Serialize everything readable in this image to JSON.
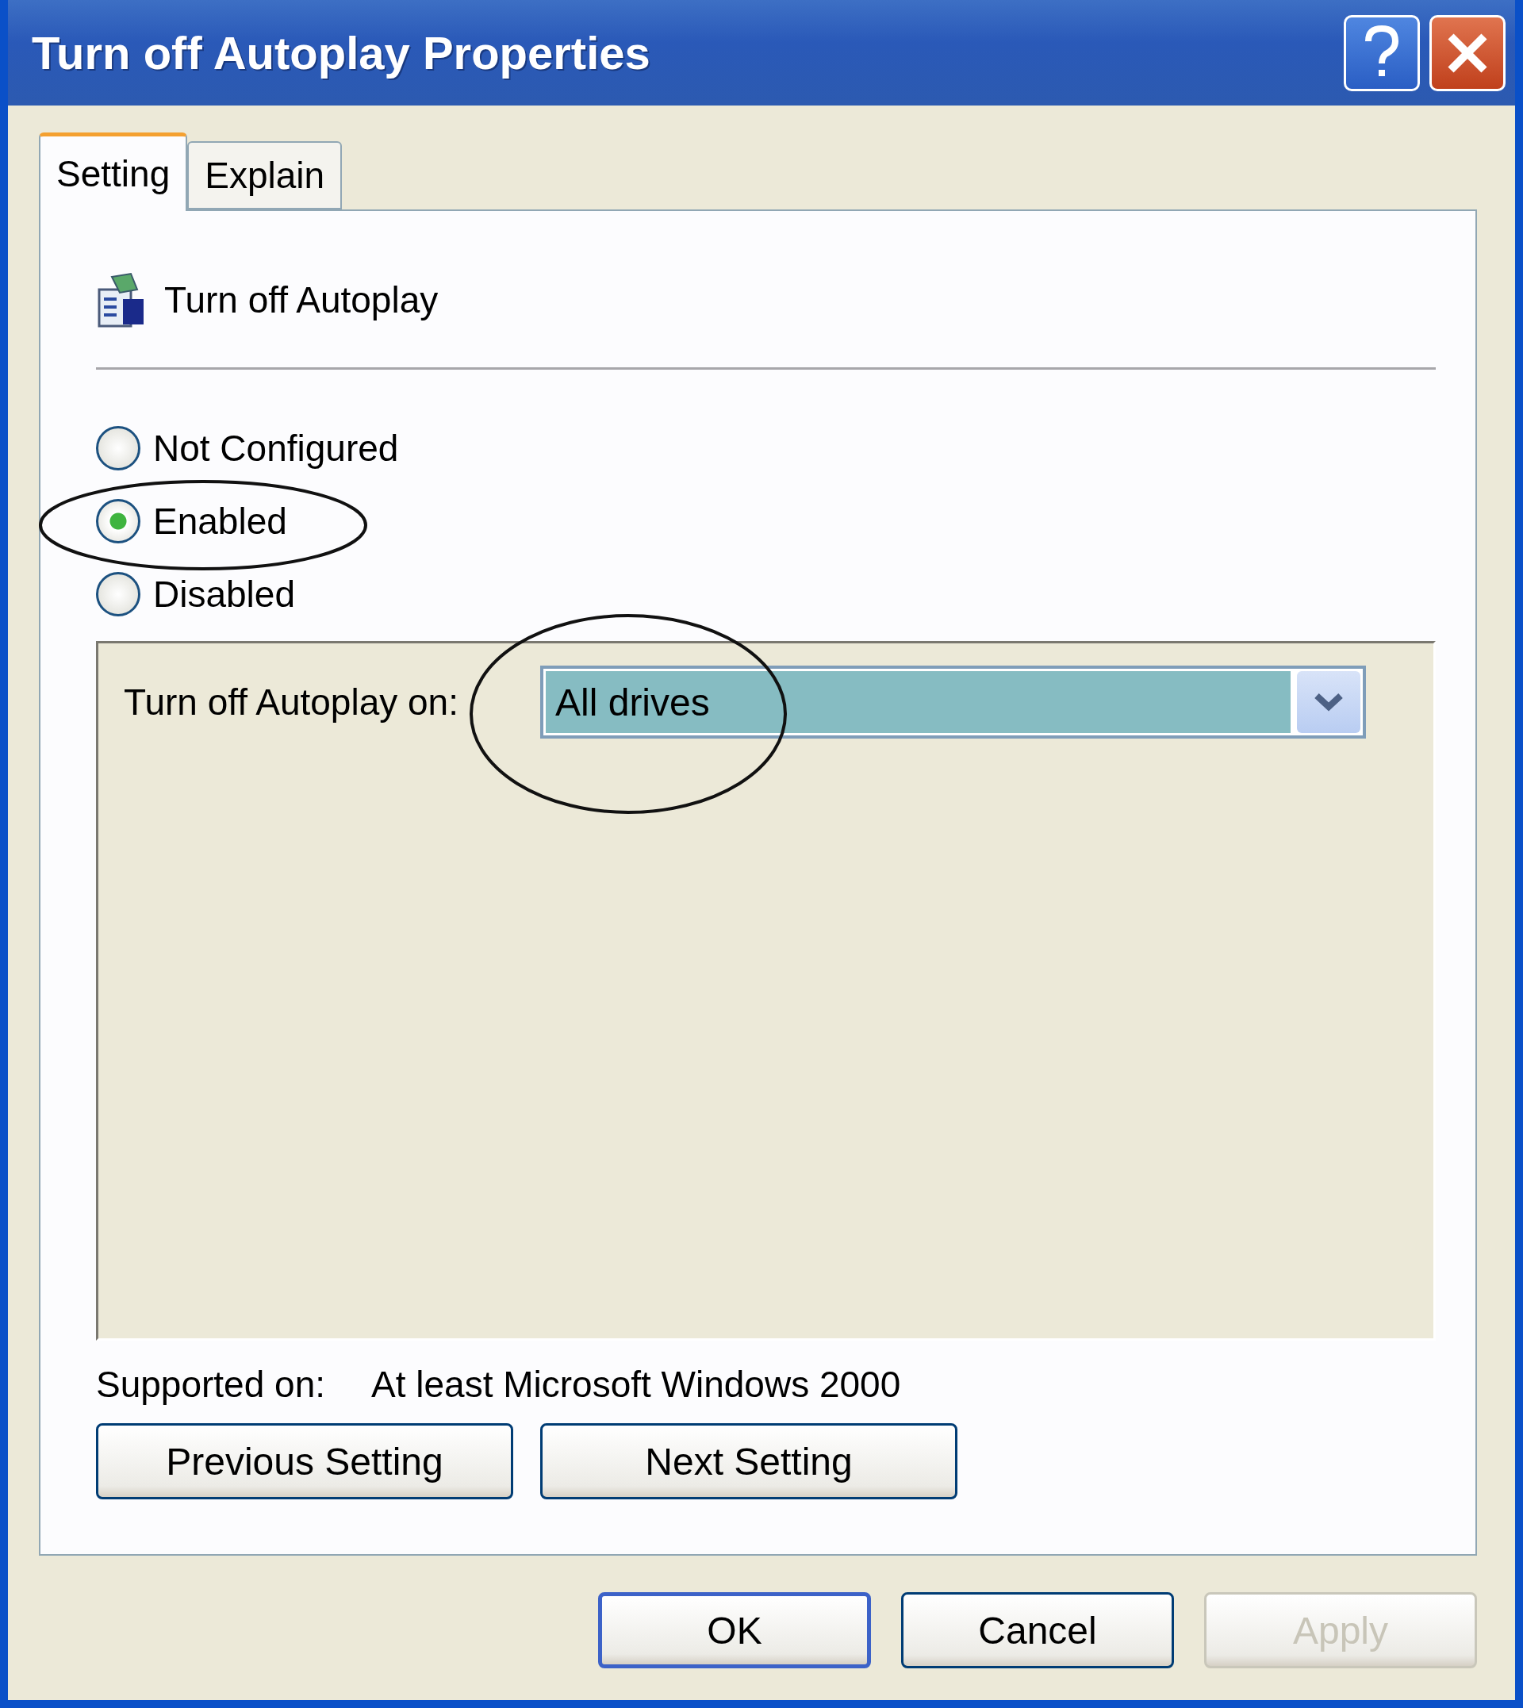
{
  "window": {
    "title": "Turn off Autoplay Properties"
  },
  "tabs": [
    {
      "label": "Setting",
      "selected": true
    },
    {
      "label": "Explain",
      "selected": false
    }
  ],
  "policy": {
    "name": "Turn off Autoplay"
  },
  "options": [
    {
      "label": "Not Configured",
      "selected": false
    },
    {
      "label": "Enabled",
      "selected": true
    },
    {
      "label": "Disabled",
      "selected": false
    }
  ],
  "autoplay_option": {
    "label": "Turn off Autoplay on:",
    "value": "All drives"
  },
  "supported_on": {
    "label": "Supported on:",
    "value": "At least Microsoft Windows 2000"
  },
  "nav_buttons": [
    {
      "label": "Previous Setting"
    },
    {
      "label": "Next Setting"
    }
  ],
  "dialog_buttons": [
    {
      "label": "OK",
      "disabled": false,
      "default": true
    },
    {
      "label": "Cancel",
      "disabled": false,
      "default": false
    },
    {
      "label": "Apply",
      "disabled": true,
      "default": false
    }
  ]
}
